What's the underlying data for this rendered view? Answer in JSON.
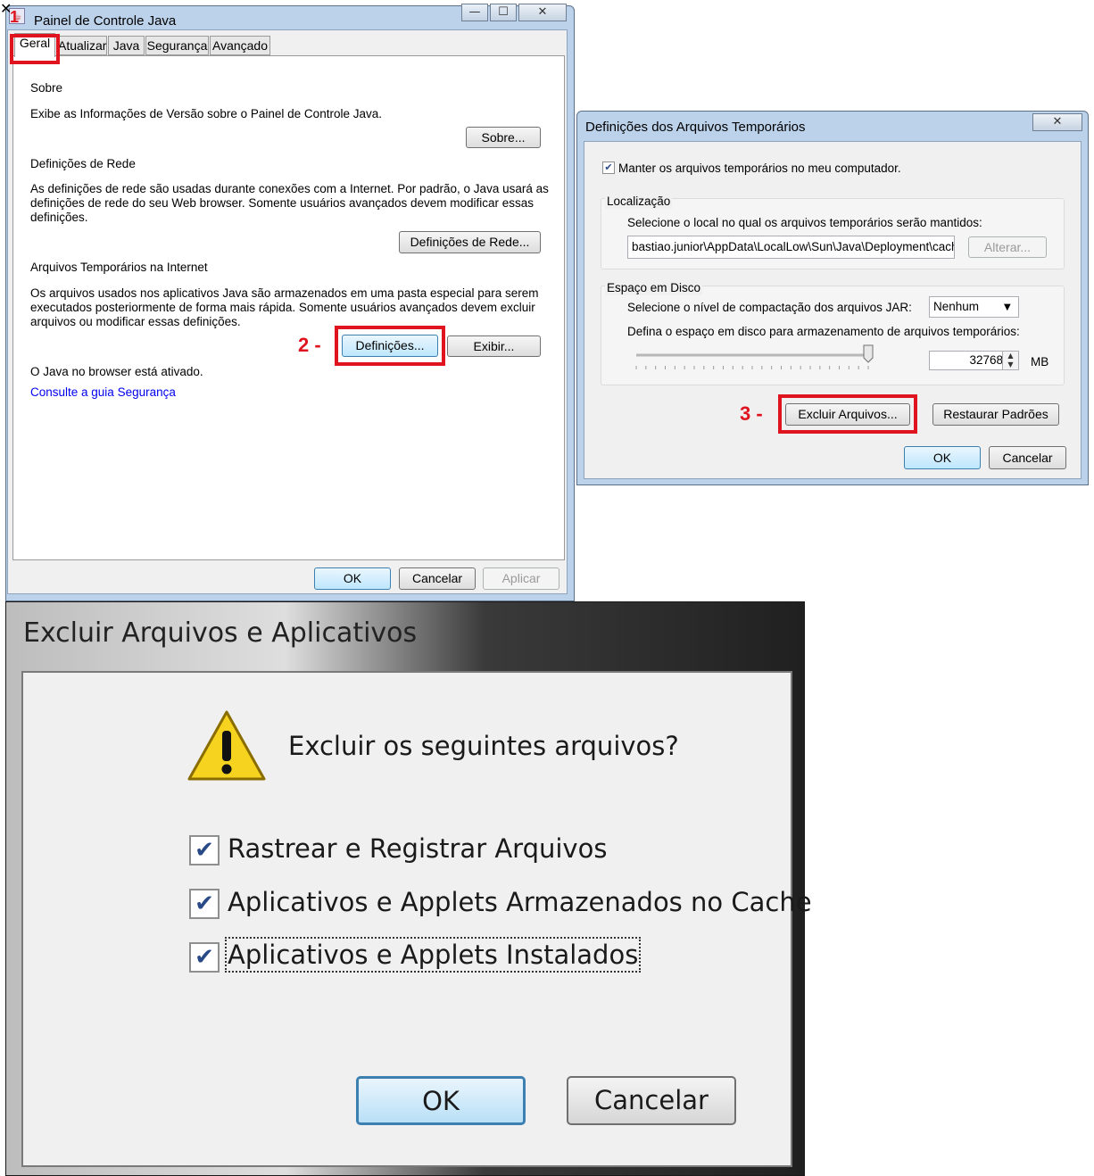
{
  "win1": {
    "title": "Painel de Controle Java",
    "tabs": [
      "Geral",
      "Atualizar",
      "Java",
      "Segurança",
      "Avançado"
    ],
    "sobre_heading": "Sobre",
    "sobre_desc": "Exibe as Informações de Versão sobre o Painel de Controle Java.",
    "sobre_button": "Sobre...",
    "rede_heading": "Definições de Rede",
    "rede_desc_lines": [
      "As definições de rede são usadas durante conexões com a Internet. Por padrão, o Java usará as",
      "definições de rede do seu Web browser. Somente usuários avançados devem modificar essas",
      "definições."
    ],
    "rede_button": "Definições de Rede...",
    "temp_heading": "Arquivos Temporários na Internet",
    "temp_desc_lines": [
      "Os arquivos usados nos aplicativos Java são armazenados em uma pasta especial para serem",
      "executados posteriormente de forma mais rápida. Somente usuários avançados devem excluir",
      "arquivos ou modificar essas definições."
    ],
    "definicoes_button": "Definições...",
    "exibir_button": "Exibir...",
    "browser_status": "O Java no browser está ativado.",
    "security_link": "Consulte a guia Segurança",
    "ok": "OK",
    "cancel": "Cancelar",
    "apply": "Aplicar",
    "step1": "1",
    "step2": "2 -"
  },
  "win2": {
    "title": "Definições dos Arquivos Temporários",
    "keep_files_label": "Manter os arquivos temporários no meu computador.",
    "keep_files_checked": true,
    "location_group": "Localização",
    "location_desc": "Selecione o local no qual os arquivos temporários serão mantidos:",
    "location_path": "bastiao.junior\\AppData\\LocalLow\\Sun\\Java\\Deployment\\cache",
    "change_button": "Alterar...",
    "disk_group": "Espaço em Disco",
    "compression_label": "Selecione o nível de compactação dos arquivos JAR:",
    "compression_value": "Nenhum",
    "space_label": "Defina o espaço em disco para armazenamento de arquivos temporários:",
    "space_value": "32768",
    "space_unit": "MB",
    "slider_level": 1.0,
    "delete_button": "Excluir Arquivos...",
    "restore_button": "Restaurar Padrões",
    "ok": "OK",
    "cancel": "Cancelar",
    "step3": "3 -"
  },
  "win3": {
    "title": "Excluir Arquivos e Aplicativos",
    "question": "Excluir os seguintes arquivos?",
    "options": [
      {
        "label": "Rastrear e Registrar Arquivos",
        "checked": true
      },
      {
        "label": "Aplicativos e Applets Armazenados no Cache",
        "checked": true
      },
      {
        "label": "Aplicativos e Applets Instalados",
        "checked": true
      }
    ],
    "ok": "OK",
    "cancel": "Cancelar"
  },
  "colors": {
    "highlight": "#e0141e",
    "link": "#0000ee",
    "title_bar": "#bcd2ea"
  }
}
